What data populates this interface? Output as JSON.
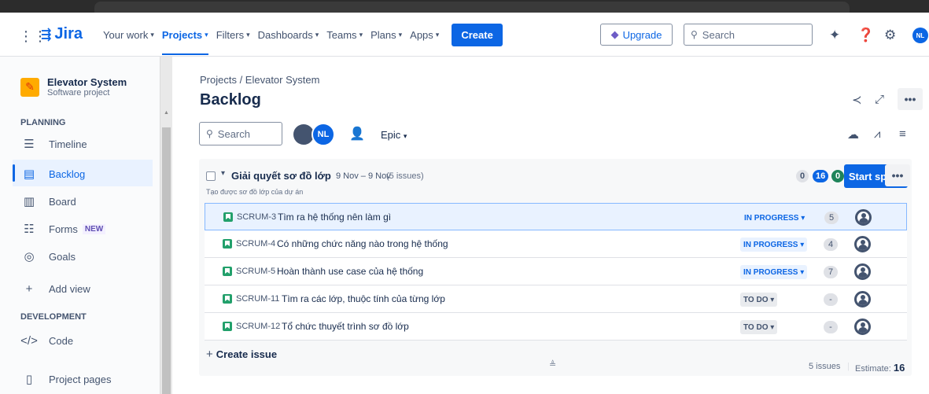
{
  "topnav": {
    "logo": "Jira",
    "links": [
      {
        "label": "Your work",
        "active": false
      },
      {
        "label": "Projects",
        "active": true
      },
      {
        "label": "Filters",
        "active": false
      },
      {
        "label": "Dashboards",
        "active": false
      },
      {
        "label": "Teams",
        "active": false
      },
      {
        "label": "Plans",
        "active": false
      },
      {
        "label": "Apps",
        "active": false
      }
    ],
    "create_label": "Create",
    "upgrade_label": "Upgrade",
    "search_placeholder": "Search",
    "user_initials": "NL",
    "accent": "#0c66e4"
  },
  "sidebar": {
    "project_name": "Elevator System",
    "project_type": "Software project",
    "planning_heading": "PLANNING",
    "items": [
      {
        "label": "Timeline",
        "icon": "timeline-icon"
      },
      {
        "label": "Backlog",
        "icon": "backlog-icon",
        "active": true
      },
      {
        "label": "Board",
        "icon": "board-icon"
      },
      {
        "label": "Forms",
        "icon": "forms-icon",
        "badge": "NEW"
      },
      {
        "label": "Goals",
        "icon": "goals-icon"
      },
      {
        "label": "Add view",
        "icon": "plus-icon"
      }
    ],
    "development_heading": "DEVELOPMENT",
    "code_label": "Code",
    "project_pages_label": "Project pages"
  },
  "main": {
    "breadcrumb": "Projects / Elevator System",
    "title": "Backlog",
    "search_placeholder": "Search",
    "avatar_initials": "NL",
    "epic_label": "Epic"
  },
  "sprint": {
    "name": "Giải quyết sơ đồ lớp",
    "dates": "9 Nov – 9 Nov",
    "issue_count": "(5 issues)",
    "goal": "Tạo được sơ đồ lớp của dự án",
    "todo_points": "0",
    "inprogress_points": "16",
    "done_points": "0",
    "start_label": "Start sprint",
    "status_colors": {
      "todo": "#dfe1e6",
      "in_progress": "#0c66e4",
      "done": "#1f845a"
    }
  },
  "issues": [
    {
      "key": "SCRUM-3",
      "summary": "Tìm ra hệ thống nên làm gì",
      "status": "IN PROGRESS",
      "points": "5",
      "selected": true
    },
    {
      "key": "SCRUM-4",
      "summary": "Có những chức năng nào trong hệ thống",
      "status": "IN PROGRESS",
      "points": "4"
    },
    {
      "key": "SCRUM-5",
      "summary": "Hoàn thành use case của hệ thống",
      "status": "IN PROGRESS",
      "points": "7"
    },
    {
      "key": "SCRUM-11",
      "summary": "Tìm ra các lớp, thuộc tính của từng lớp",
      "status": "TO DO",
      "points": "-"
    },
    {
      "key": "SCRUM-12",
      "summary": "Tổ chức thuyết trình sơ đồ lớp",
      "status": "TO DO",
      "points": "-"
    }
  ],
  "create_issue_label": "Create issue",
  "footer": {
    "issues": "5 issues",
    "estimate_label": "Estimate:",
    "estimate_value": "16"
  }
}
